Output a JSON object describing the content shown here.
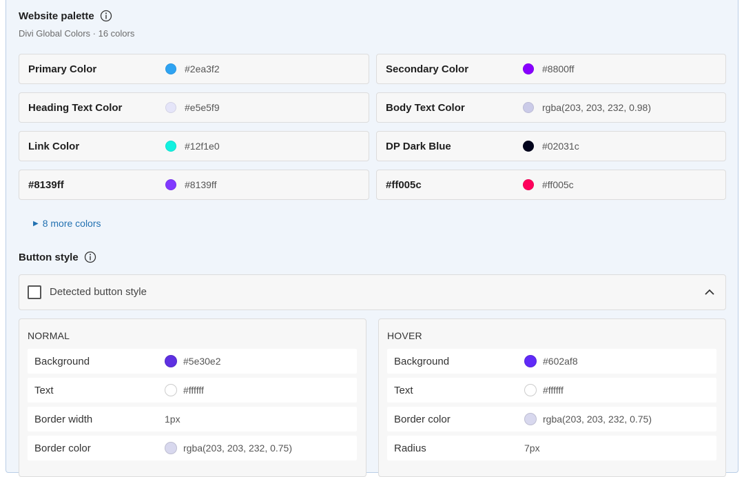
{
  "palette": {
    "title": "Website palette",
    "subtitle": "Divi Global Colors · 16 colors",
    "colors": [
      {
        "name": "Primary Color",
        "value": "#2ea3f2",
        "swatch": "#2ea3f2"
      },
      {
        "name": "Secondary Color",
        "value": "#8800ff",
        "swatch": "#8800ff"
      },
      {
        "name": "Heading Text Color",
        "value": "#e5e5f9",
        "swatch": "#e5e5f9"
      },
      {
        "name": "Body Text Color",
        "value": "rgba(203, 203, 232, 0.98)",
        "swatch": "#cbcbe8"
      },
      {
        "name": "Link Color",
        "value": "#12f1e0",
        "swatch": "#12f1e0"
      },
      {
        "name": "DP Dark Blue",
        "value": "#02031c",
        "swatch": "#02031c"
      },
      {
        "name": "#8139ff",
        "value": "#8139ff",
        "swatch": "#8139ff"
      },
      {
        "name": "#ff005c",
        "value": "#ff005c",
        "swatch": "#ff005c"
      }
    ],
    "more_label": "8 more colors"
  },
  "button_style": {
    "title": "Button style",
    "detected_label": "Detected button style",
    "detected_checked": false,
    "normal": {
      "heading": "NORMAL",
      "rows": [
        {
          "label": "Background",
          "value": "#5e30e2",
          "swatch": "#5e30e2"
        },
        {
          "label": "Text",
          "value": "#ffffff",
          "swatch": "#ffffff"
        },
        {
          "label": "Border width",
          "value": "1px",
          "swatch": null
        },
        {
          "label": "Border color",
          "value": "rgba(203, 203, 232, 0.75)",
          "swatch": "#d8d8ee"
        }
      ]
    },
    "hover": {
      "heading": "HOVER",
      "rows": [
        {
          "label": "Background",
          "value": "#602af8",
          "swatch": "#602af8"
        },
        {
          "label": "Text",
          "value": "#ffffff",
          "swatch": "#ffffff"
        },
        {
          "label": "Border color",
          "value": "rgba(203, 203, 232, 0.75)",
          "swatch": "#d8d8ee"
        },
        {
          "label": "Radius",
          "value": "7px",
          "swatch": null
        }
      ]
    }
  },
  "icons": {
    "info": "info-icon",
    "chevron": "chevron-up-icon",
    "disclosure": "triangle-right-icon"
  },
  "colors": {
    "frame_bg": "#f0f5fb",
    "frame_border": "#b9cde6",
    "link": "#2271b1"
  }
}
